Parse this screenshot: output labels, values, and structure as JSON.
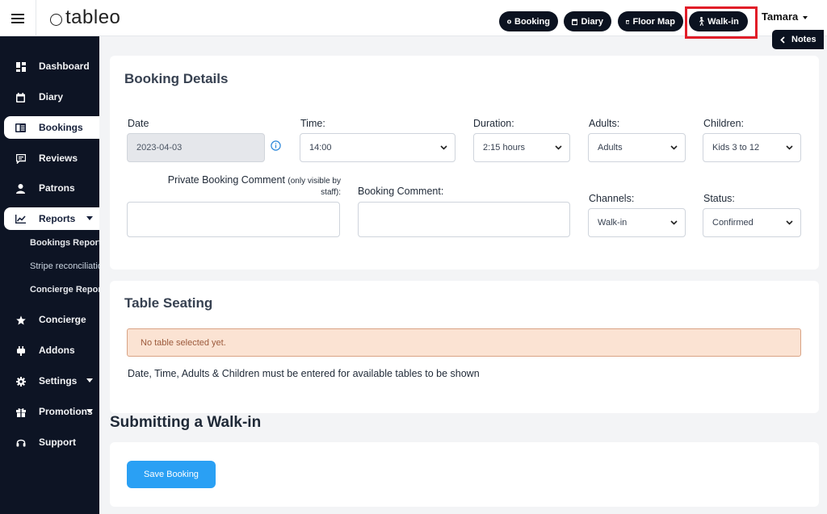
{
  "app": {
    "logo_text": "tableo",
    "user_name": "Tamara"
  },
  "header": {
    "buttons": {
      "booking": "Booking",
      "diary": "Diary",
      "floor_map": "Floor Map",
      "walk_in": "Walk-in"
    },
    "notes_label": "Notes"
  },
  "sidebar": {
    "items": [
      {
        "label": "Dashboard",
        "icon": "dashboard-icon"
      },
      {
        "label": "Diary",
        "icon": "calendar-icon"
      },
      {
        "label": "Bookings",
        "icon": "book-icon"
      },
      {
        "label": "Reviews",
        "icon": "comment-icon"
      },
      {
        "label": "Patrons",
        "icon": "user-icon"
      },
      {
        "label": "Reports",
        "icon": "chart-icon"
      },
      {
        "label": "Concierge",
        "icon": "star-icon"
      },
      {
        "label": "Addons",
        "icon": "plug-icon"
      },
      {
        "label": "Settings",
        "icon": "gear-icon"
      },
      {
        "label": "Promotions",
        "icon": "gift-icon"
      },
      {
        "label": "Support",
        "icon": "headset-icon"
      }
    ],
    "report_subitems": [
      "Bookings Report",
      "Stripe reconciliation",
      "Concierge Report"
    ]
  },
  "booking_details": {
    "title": "Booking Details",
    "date_label": "Date",
    "date_value": "2023-04-03",
    "time_label": "Time:",
    "time_value": "14:00",
    "duration_label": "Duration:",
    "duration_value": "2:15 hours",
    "adults_label": "Adults:",
    "adults_value": "Adults",
    "children_label": "Children:",
    "children_value": "Kids 3 to 12",
    "private_comment_label": "Private Booking Comment",
    "private_comment_note": "(only visible by staff):",
    "booking_comment_label": "Booking Comment:",
    "channels_label": "Channels:",
    "channels_value": "Walk-in",
    "status_label": "Status:",
    "status_value": "Confirmed"
  },
  "table_seating": {
    "title": "Table Seating",
    "alert": "No table selected yet.",
    "hint": "Date, Time, Adults & Children must be entered for available tables to be shown"
  },
  "submit_section": {
    "heading": "Submitting a Walk-in",
    "save_label": "Save Booking"
  },
  "colors": {
    "sidebar_bg": "#0d1424",
    "pill_bg": "#0b1220",
    "highlight": "#e11d28",
    "save_button": "#2aa0f4",
    "alert_bg": "#fbe3d3"
  }
}
